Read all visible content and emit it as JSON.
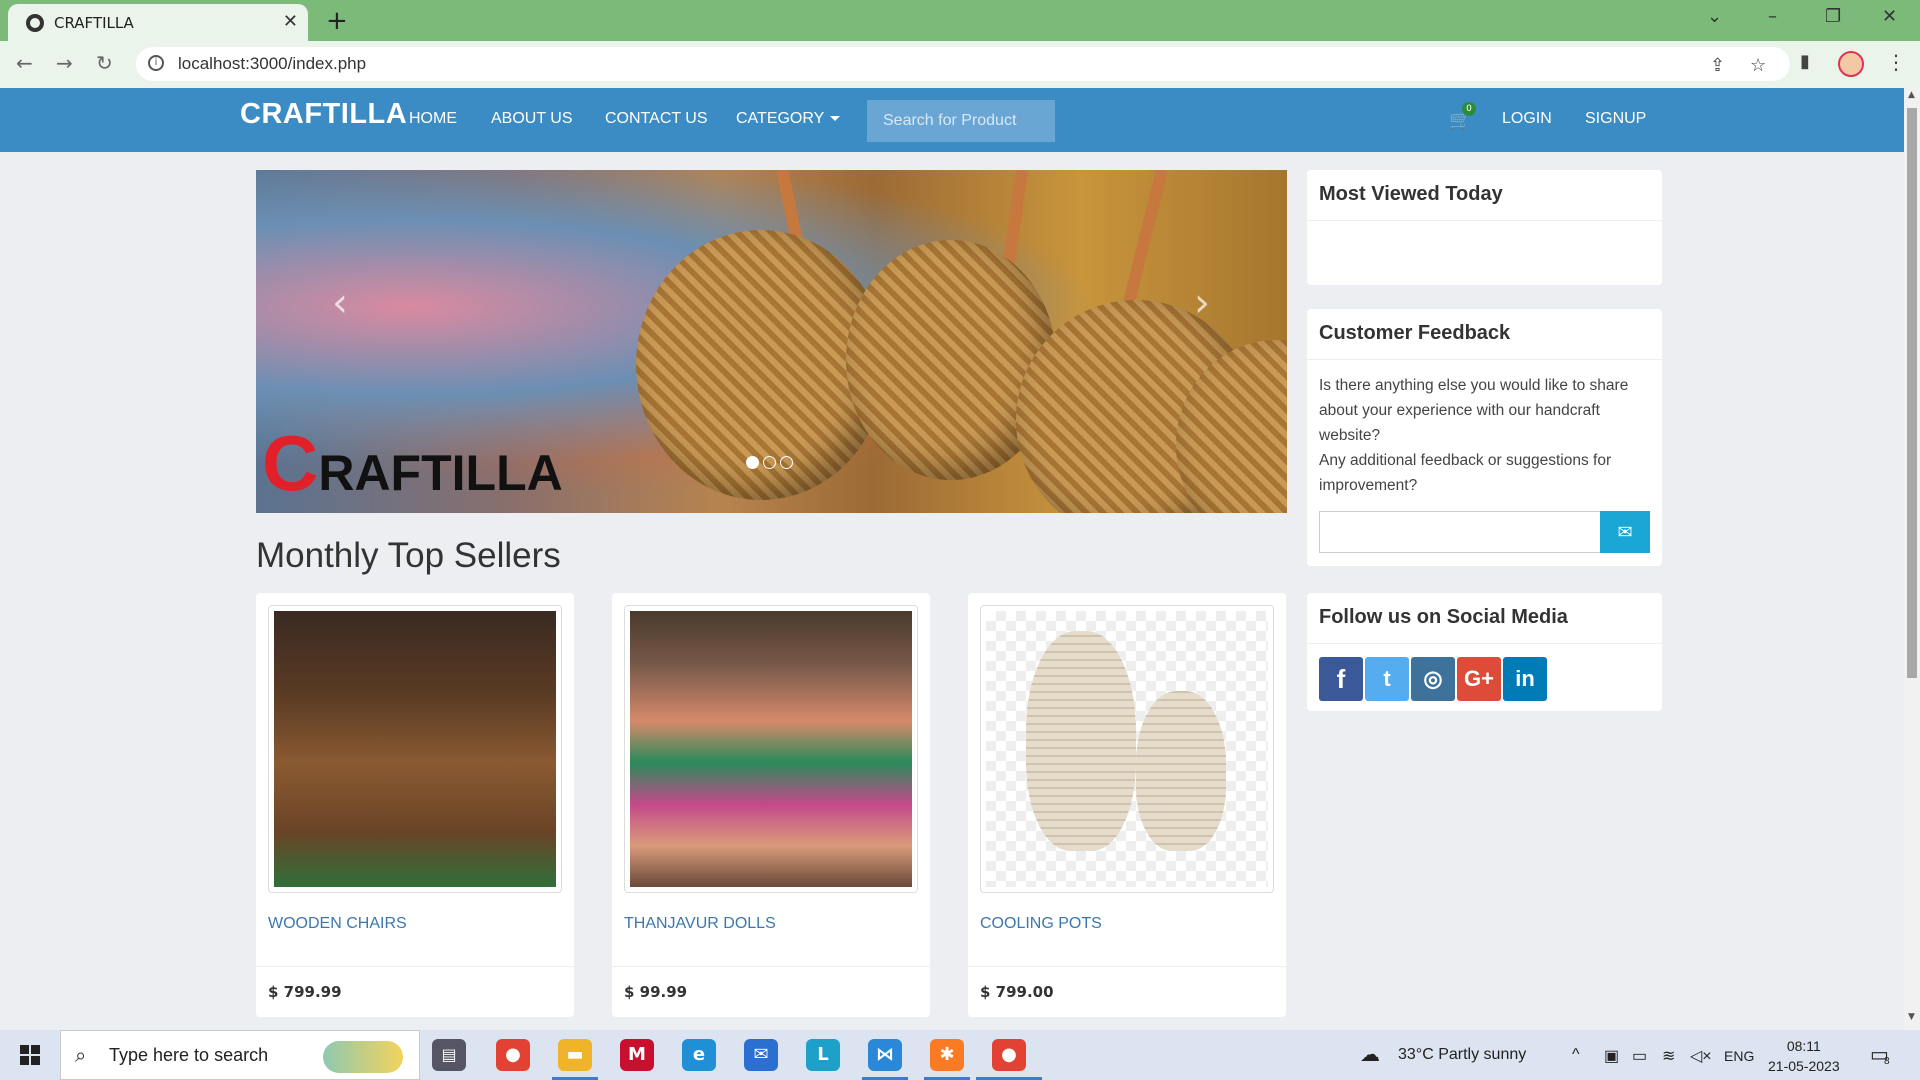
{
  "browser": {
    "tab_title": "CRAFTILLA",
    "url": "localhost:3000/index.php"
  },
  "site": {
    "brand": "CRAFTILLA",
    "nav": {
      "home": "HOME",
      "about": "ABOUT US",
      "contact": "CONTACT US",
      "category": "CATEGORY",
      "login": "LOGIN",
      "signup": "SIGNUP"
    },
    "search_placeholder": "Search for Product",
    "cart_count": "0"
  },
  "carousel": {
    "logo_first": "C",
    "logo_rest": "RAFTILLA",
    "slides": 3,
    "active_slide": 1
  },
  "main": {
    "section_title": "Monthly Top Sellers",
    "products": [
      {
        "name": "WOODEN CHAIRS",
        "price": "$ 799.99"
      },
      {
        "name": "THANJAVUR DOLLS",
        "price": "$ 99.99"
      },
      {
        "name": "COOLING POTS",
        "price": "$ 799.00"
      }
    ]
  },
  "sidebar": {
    "most_viewed_title": "Most Viewed Today",
    "feedback_title": "Customer Feedback",
    "feedback_text_1": "Is there anything else you would like to share about your experience with our handcraft website?",
    "feedback_text_2": "Any additional feedback or suggestions for improvement?",
    "social_title": "Follow us on Social Media",
    "social": [
      {
        "icon": "facebook-icon",
        "glyph": "f",
        "color": "#3b5998"
      },
      {
        "icon": "twitter-icon",
        "glyph": "t",
        "color": "#55acee"
      },
      {
        "icon": "instagram-icon",
        "glyph": "◎",
        "color": "#3f729b"
      },
      {
        "icon": "google-plus-icon",
        "glyph": "G+",
        "color": "#dd4b39"
      },
      {
        "icon": "linkedin-icon",
        "glyph": "in",
        "color": "#007bb5"
      }
    ]
  },
  "taskbar": {
    "search_text": "Type here to search",
    "weather": "33°C  Partly sunny",
    "lang": "ENG",
    "time": "08:11",
    "date": "21-05-2023",
    "notifications": "8"
  }
}
